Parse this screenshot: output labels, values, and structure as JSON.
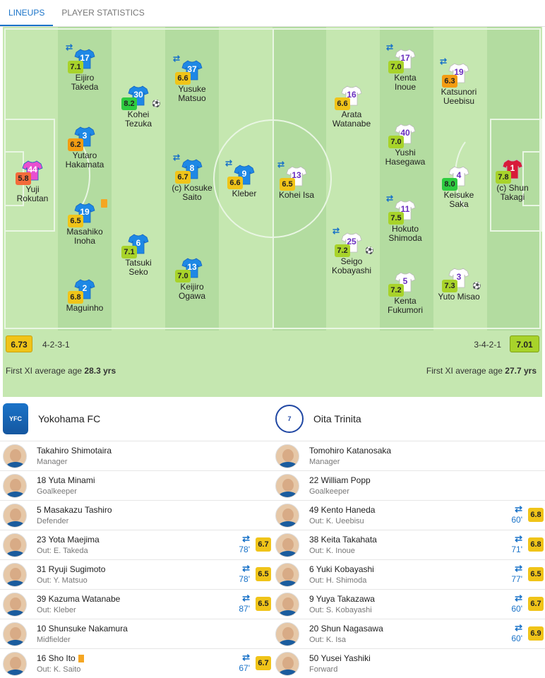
{
  "tabs": [
    "LINEUPS",
    "PLAYER STATISTICS"
  ],
  "home": {
    "name": "Yokohama FC",
    "formation": "4-2-3-1",
    "avg_rating": "6.73",
    "avg_age_label": "First XI average age",
    "avg_age": "28.3 yrs",
    "shirt_color": "#1e88e5",
    "gk_color": "#e94fd0"
  },
  "away": {
    "name": "Oita Trinita",
    "formation": "3-4-2-1",
    "avg_rating": "7.01",
    "avg_age_label": "First XI average age",
    "avg_age": "27.7 yrs",
    "shirt_color": "#ffffff",
    "gk_color": "#d81b3a"
  },
  "home_players": [
    {
      "num": "44",
      "name": "Yuji\nRokutan",
      "rating": "5.8",
      "rc": "#f36b3b",
      "gk": true
    },
    {
      "num": "17",
      "name": "Eijiro\nTakeda",
      "rating": "7.1",
      "rc": "#a8d32a",
      "sub": true
    },
    {
      "num": "3",
      "name": "Yutaro\nHakamata",
      "rating": "6.2",
      "rc": "#f39c12"
    },
    {
      "num": "19",
      "name": "Masahiko\nInoha",
      "rating": "6.5",
      "rc": "#f0c419",
      "card": true
    },
    {
      "num": "2",
      "name": "Maguinho",
      "rating": "6.8",
      "rc": "#f0c419"
    },
    {
      "num": "30",
      "name": "Kohei\nTezuka",
      "rating": "8.2",
      "rc": "#2ecc40",
      "goal": true
    },
    {
      "num": "6",
      "name": "Tatsuki\nSeko",
      "rating": "7.1",
      "rc": "#a8d32a"
    },
    {
      "num": "37",
      "name": "Yusuke\nMatsuo",
      "rating": "6.6",
      "rc": "#f0c419",
      "sub": true
    },
    {
      "num": "8",
      "name": "(c) Kosuke\nSaito",
      "rating": "6.7",
      "rc": "#f0c419",
      "sub": true
    },
    {
      "num": "13",
      "name": "Keijiro\nOgawa",
      "rating": "7.0",
      "rc": "#a8d32a"
    },
    {
      "num": "9",
      "name": "Kleber",
      "rating": "6.6",
      "rc": "#f0c419",
      "sub": true
    }
  ],
  "away_players": [
    {
      "num": "13",
      "name": "Kohei Isa",
      "rating": "6.5",
      "rc": "#f0c419",
      "sub": true
    },
    {
      "num": "16",
      "name": "Arata\nWatanabe",
      "rating": "6.6",
      "rc": "#f0c419"
    },
    {
      "num": "25",
      "name": "Seigo\nKobayashi",
      "rating": "7.2",
      "rc": "#a8d32a",
      "sub": true,
      "goal": true
    },
    {
      "num": "17",
      "name": "Kenta\nInoue",
      "rating": "7.0",
      "rc": "#a8d32a",
      "sub": true
    },
    {
      "num": "40",
      "name": "Yushi\nHasegawa",
      "rating": "7.0",
      "rc": "#a8d32a"
    },
    {
      "num": "11",
      "name": "Hokuto\nShimoda",
      "rating": "7.5",
      "rc": "#a8d32a",
      "sub": true
    },
    {
      "num": "5",
      "name": "Kenta\nFukumori",
      "rating": "7.2",
      "rc": "#a8d32a"
    },
    {
      "num": "19",
      "name": "Katsunori\nUeebisu",
      "rating": "6.3",
      "rc": "#f39c12",
      "sub": true
    },
    {
      "num": "4",
      "name": "Keisuke\nSaka",
      "rating": "8.0",
      "rc": "#2ecc40"
    },
    {
      "num": "3",
      "name": "Yuto Misao",
      "rating": "7.3",
      "rc": "#a8d32a",
      "goal": true
    },
    {
      "num": "1",
      "name": "(c) Shun\nTakagi",
      "rating": "7.8",
      "rc": "#a8d32a",
      "gk": true
    }
  ],
  "home_list": [
    {
      "line": "Takahiro Shimotaira",
      "sub": "Manager"
    },
    {
      "line": "18  Yuta Minami",
      "sub": "Goalkeeper"
    },
    {
      "line": "5  Masakazu Tashiro",
      "sub": "Defender"
    },
    {
      "line": "23  Yota Maejima",
      "sub": "Out: E. Takeda",
      "min": "78'",
      "rating": "6.7"
    },
    {
      "line": "31  Ryuji Sugimoto",
      "sub": "Out: Y. Matsuo",
      "min": "78'",
      "rating": "6.5"
    },
    {
      "line": "39  Kazuma Watanabe",
      "sub": "Out: Kleber",
      "min": "87'",
      "rating": "6.5"
    },
    {
      "line": "10  Shunsuke Nakamura",
      "sub": "Midfielder"
    },
    {
      "line": "16  Sho Ito",
      "sub": "Out: K. Saito",
      "min": "67'",
      "rating": "6.7",
      "card": true
    }
  ],
  "away_list": [
    {
      "line": "Tomohiro Katanosaka",
      "sub": "Manager"
    },
    {
      "line": "22  William Popp",
      "sub": "Goalkeeper"
    },
    {
      "line": "49  Kento Haneda",
      "sub": "Out: K. Ueebisu",
      "min": "60'",
      "rating": "6.8"
    },
    {
      "line": "38  Keita Takahata",
      "sub": "Out: K. Inoue",
      "min": "71'",
      "rating": "6.8"
    },
    {
      "line": "6  Yuki Kobayashi",
      "sub": "Out: H. Shimoda",
      "min": "77'",
      "rating": "6.5"
    },
    {
      "line": "9  Yuya Takazawa",
      "sub": "Out: S. Kobayashi",
      "min": "60'",
      "rating": "6.7"
    },
    {
      "line": "20  Shun Nagasawa",
      "sub": "Out: K. Isa",
      "min": "60'",
      "rating": "6.9"
    },
    {
      "line": "50  Yusei Yashiki",
      "sub": "Forward"
    }
  ]
}
